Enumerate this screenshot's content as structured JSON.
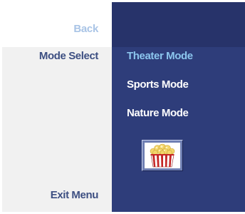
{
  "left_column": {
    "back_label": "Back",
    "mode_select_label": "Mode Select",
    "exit_menu_label": "Exit Menu"
  },
  "mode_menu": {
    "items": [
      {
        "label": "Theater Mode",
        "selected": true
      },
      {
        "label": "Sports Mode",
        "selected": false
      },
      {
        "label": "Nature Mode",
        "selected": false
      }
    ],
    "mode_icon": "popcorn-icon"
  },
  "colors": {
    "panel_background": "#2e3d7a",
    "left_background": "#f1f1f1",
    "selected_item": "#8cc6ee",
    "back_label": "#a9c4e6",
    "left_label": "#3d4f82"
  }
}
